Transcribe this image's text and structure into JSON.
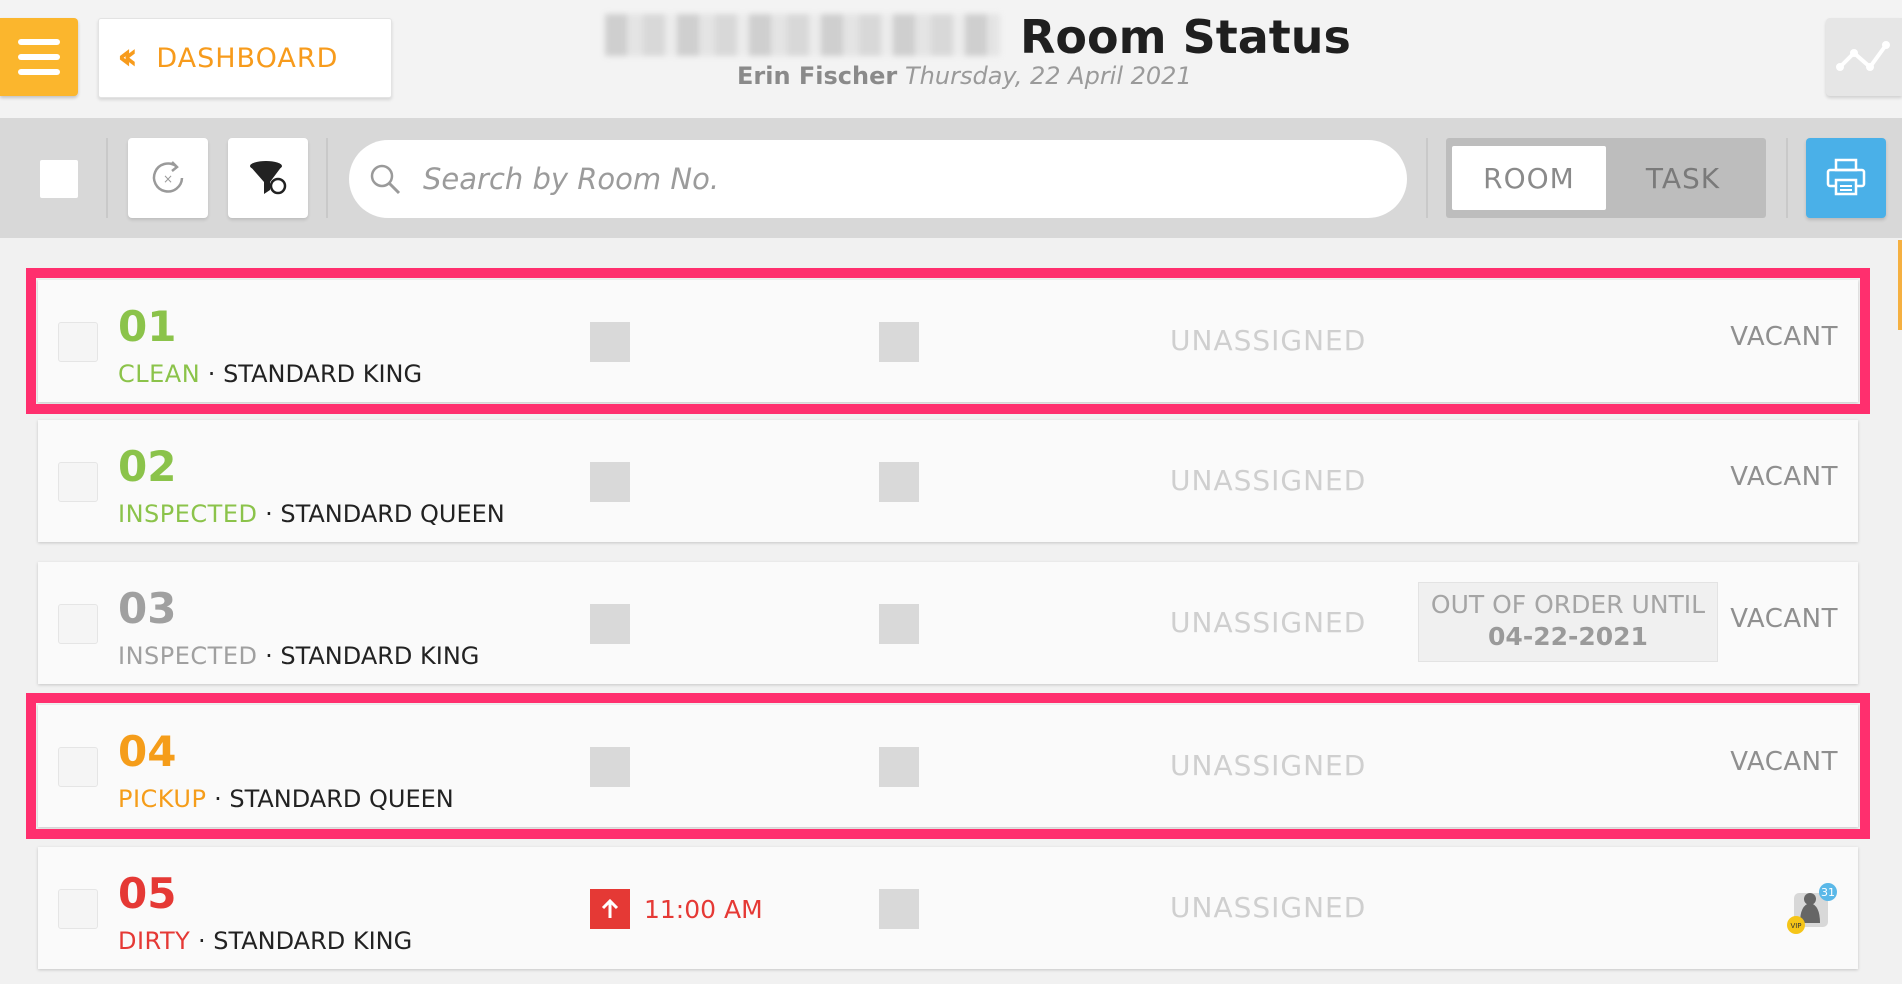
{
  "header": {
    "dashboard_label": "DASHBOARD",
    "title": "Room Status",
    "user": "Erin Fischer",
    "date": "Thursday, 22 April 2021"
  },
  "toolbar": {
    "search_placeholder": "Search by Room No.",
    "toggle": {
      "room": "ROOM",
      "task": "TASK",
      "active": "ROOM"
    }
  },
  "rooms": [
    {
      "number": "01",
      "status": "CLEAN",
      "sep": " · ",
      "type": "STANDARD KING",
      "assignment": "UNASSIGNED",
      "occupancy": "VACANT",
      "color": "#8bc34a",
      "highlighted": true
    },
    {
      "number": "02",
      "status": "INSPECTED",
      "sep": " · ",
      "type": "STANDARD QUEEN",
      "assignment": "UNASSIGNED",
      "occupancy": "VACANT",
      "color": "#8bc34a",
      "highlighted": false
    },
    {
      "number": "03",
      "status": "INSPECTED",
      "sep": " · ",
      "type": "STANDARD KING",
      "assignment": "UNASSIGNED",
      "occupancy": "VACANT",
      "color": "#a0a0a0",
      "out_of_order_label": "OUT OF ORDER UNTIL",
      "out_of_order_date": "04-22-2021",
      "highlighted": false
    },
    {
      "number": "04",
      "status": "PICKUP",
      "sep": " · ",
      "type": "STANDARD QUEEN",
      "assignment": "UNASSIGNED",
      "occupancy": "VACANT",
      "color": "#f59d1a",
      "highlighted": true
    },
    {
      "number": "05",
      "status": "DIRTY",
      "sep": " · ",
      "type": "STANDARD KING",
      "assignment": "UNASSIGNED",
      "due_time": "11:00 AM",
      "guest_badge_count": "31",
      "vip_label": "VIP",
      "color": "#e53935",
      "highlighted": false
    }
  ],
  "icons": {
    "menu": "hamburger-icon",
    "back": "double-chevron-left-icon",
    "graph": "line-graph-icon",
    "refresh": "refresh-icon",
    "filter": "filter-icon",
    "search": "search-icon",
    "print": "print-icon",
    "due": "arrow-up-icon",
    "guest": "guest-icon"
  },
  "colors": {
    "accent": "#f79b1c",
    "highlight": "#ff2f6e",
    "print": "#4ab0e8",
    "menu": "#fbb62d"
  }
}
